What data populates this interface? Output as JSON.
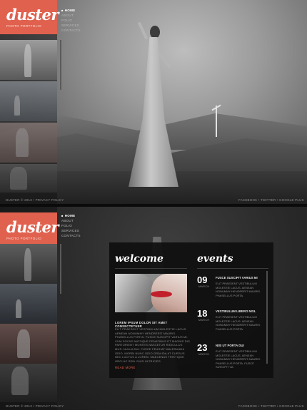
{
  "brand": {
    "name": "duster",
    "tagline": "PHOTO PORTFOLIO",
    "accent_color": "#e0614e"
  },
  "nav": {
    "items": [
      "HOME",
      "ABOUT",
      "FOLIO",
      "SERVICES",
      "CONTACTS"
    ],
    "active_index": 0
  },
  "footer": {
    "left": "DUSTER © 2013 • PRIVACY POLICY",
    "right": "FACEBOOK • TWITTER • GOOGLE PLUS"
  },
  "welcome": {
    "title": "welcome",
    "post_title": "LOREM IPSUM DOLOR SIT AMET CONSECTETUER",
    "post_body": "ELIT PRAESENT VESTIBULUM MOLESTIE LACUS. AENEAN NONUMMY HENDRERIT MAURIS. PHASELLUS PORTA. FUSCE SUSCIPIT VARIUS MI. CUM SOCIIS NATOQUE PENATIBUS ET MAGNIS DIS PARTURIENT MONTES NASCETUR RIDICULUS MUS. NULLA DUI. FUSCE FEUGIAT MALESUADA ODIO. MORBI NUNC ODIO GRAVIDA AT CURSUS NEC LUCTUS A LOREM. MAECENAS TRISTIQUE ORCI AC SEM. DUIS ULTRICIES",
    "read_more": "READ MORE"
  },
  "events": {
    "title": "events",
    "items": [
      {
        "day": "09",
        "month": "MARCH",
        "title": "FUSCE SUSCIPIT VARIUS MI",
        "text": "ELIT PRAESENT VESTIBULUM MOLESTIE LACUS. AENEAN NONUMMY HENDRERIT MAURIS. PHASELLUS PORTA."
      },
      {
        "day": "18",
        "month": "MARCH",
        "title": "VESTIBULUM LIBERO NISL",
        "text": "ELIT PRAESENT VESTIBULUM MOLESTIE LACUS. AENEAN NONUMMY HENDRERIT MAURIS. PHASELLUS PORTA."
      },
      {
        "day": "23",
        "month": "MARCH",
        "title": "NISI UT PORTA DUI",
        "text": "ELIT PRAESENT VESTIBULUM MOLESTIE LACUS. AENEAN NONUMMY HENDRERIT MAURIS. PHASELLUS PORTA. FUSCE SUSCIPIT VA."
      }
    ]
  }
}
